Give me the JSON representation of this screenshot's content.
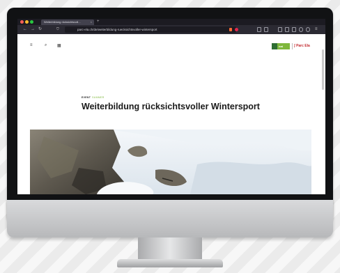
{
  "browser": {
    "tab_title": "Weiterbildung rücksichtsvoll...",
    "tab_close": "×",
    "new_tab": "+",
    "url": "parc-ela.ch/de/weiterbildung-ruecksichtsvoller-wintersport"
  },
  "site": {
    "logo_primary_text": "nat",
    "logo_secondary_text": "Parc Ela"
  },
  "article": {
    "kicker": "EVENT",
    "kicker_tag": "SUMMER",
    "headline": "Weiterbildung rücksichtsvoller Wintersport"
  },
  "colors": {
    "brand_green": "#7fb73c",
    "brand_red": "#c1272d",
    "browser_dark": "#1c1b22"
  },
  "icons": {
    "back": "←",
    "forward": "→",
    "reload": "↻",
    "shield": "⛉",
    "menu": "≡",
    "search": "⌕",
    "calendar": "▦"
  }
}
